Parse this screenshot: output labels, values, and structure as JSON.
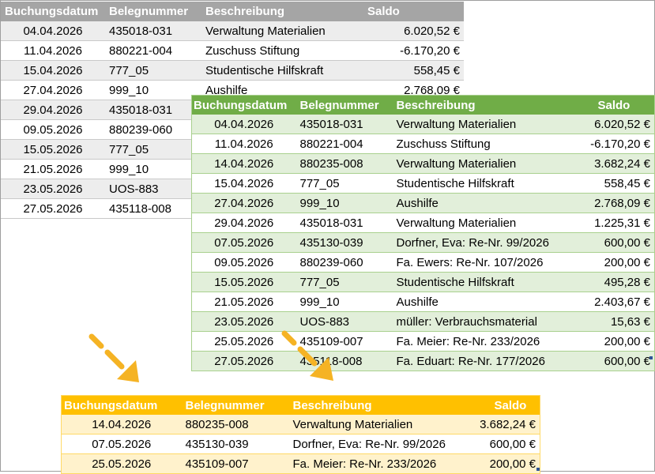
{
  "gray_table": {
    "headers": [
      "Buchungsdatum",
      "Belegnummer",
      "Beschreibung",
      "Saldo"
    ],
    "rows": [
      [
        "04.04.2026",
        "435018-031",
        "Verwaltung Materialien",
        "6.020,52 €"
      ],
      [
        "11.04.2026",
        "880221-004",
        "Zuschuss Stiftung",
        "-6.170,20 €"
      ],
      [
        "15.04.2026",
        "777_05",
        "Studentische Hilfskraft",
        "558,45 €"
      ],
      [
        "27.04.2026",
        "999_10",
        "Aushilfe",
        "2.768,09 €"
      ],
      [
        "29.04.2026",
        "435018-031",
        "",
        ""
      ],
      [
        "09.05.2026",
        "880239-060",
        "",
        ""
      ],
      [
        "15.05.2026",
        "777_05",
        "",
        ""
      ],
      [
        "21.05.2026",
        "999_10",
        "",
        ""
      ],
      [
        "23.05.2026",
        "UOS-883",
        "",
        ""
      ],
      [
        "27.05.2026",
        "435118-008",
        "",
        ""
      ]
    ]
  },
  "green_table": {
    "headers": [
      "Buchungsdatum",
      "Belegnummer",
      "Beschreibung",
      "Saldo"
    ],
    "rows": [
      [
        "04.04.2026",
        "435018-031",
        "Verwaltung Materialien",
        "6.020,52 €"
      ],
      [
        "11.04.2026",
        "880221-004",
        "Zuschuss Stiftung",
        "-6.170,20 €"
      ],
      [
        "14.04.2026",
        "880235-008",
        "Verwaltung Materialien",
        "3.682,24 €"
      ],
      [
        "15.04.2026",
        "777_05",
        "Studentische Hilfskraft",
        "558,45 €"
      ],
      [
        "27.04.2026",
        "999_10",
        "Aushilfe",
        "2.768,09 €"
      ],
      [
        "29.04.2026",
        "435018-031",
        "Verwaltung Materialien",
        "1.225,31 €"
      ],
      [
        "07.05.2026",
        "435130-039",
        "Dorfner, Eva: Re-Nr. 99/2026",
        "600,00 €"
      ],
      [
        "09.05.2026",
        "880239-060",
        "Fa. Ewers: Re-Nr. 107/2026",
        "200,00 €"
      ],
      [
        "15.05.2026",
        "777_05",
        "Studentische Hilfskraft",
        "495,28 €"
      ],
      [
        "21.05.2026",
        "999_10",
        "Aushilfe",
        "2.403,67 €"
      ],
      [
        "23.05.2026",
        "UOS-883",
        "müller: Verbrauchsmaterial",
        "15,63 €"
      ],
      [
        "25.05.2026",
        "435109-007",
        "Fa. Meier: Re-Nr. 233/2026",
        "200,00 €"
      ],
      [
        "27.05.2026",
        "435118-008",
        "Fa. Eduart: Re-Nr. 177/2026",
        "600,00 €"
      ]
    ]
  },
  "orange_table": {
    "headers": [
      "Buchungsdatum",
      "Belegnummer",
      "Beschreibung",
      "Saldo"
    ],
    "rows": [
      [
        "14.04.2026",
        "880235-008",
        "Verwaltung Materialien",
        "3.682,24 €"
      ],
      [
        "07.05.2026",
        "435130-039",
        "Dorfner, Eva: Re-Nr. 99/2026",
        "600,00 €"
      ],
      [
        "25.05.2026",
        "435109-007",
        "Fa. Meier: Re-Nr. 233/2026",
        "200,00 €"
      ]
    ]
  },
  "colors": {
    "gray_header": "#a5a5a5",
    "green_header": "#70ad47",
    "orange_header": "#ffc000",
    "arrow": "#f5b324"
  }
}
